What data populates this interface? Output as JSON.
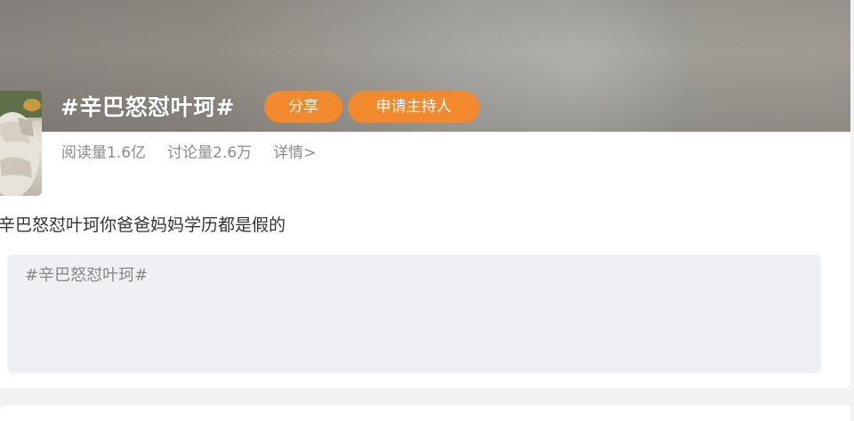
{
  "topic": {
    "title": "#辛巴怒怼叶珂#",
    "share_label": "分享",
    "apply_host_label": "申请主持人",
    "reads": "阅读量1.6亿",
    "discussions": "讨论量2.6万",
    "details_link": "详情>"
  },
  "post": {
    "description": "辛巴怒怼叶珂你爸爸妈妈学历都是假的"
  },
  "composer": {
    "placeholder": "#辛巴怒怼叶珂#"
  },
  "colors": {
    "accent": "#f28a2d",
    "compose_bg": "#eff0f4",
    "muted_text": "#8c8c8c"
  }
}
